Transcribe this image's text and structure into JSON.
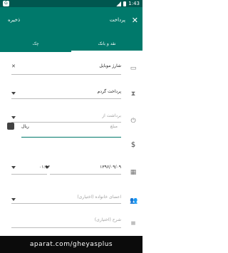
{
  "statusbar": {
    "left_badge": "G",
    "time": "1:43",
    "battery": ""
  },
  "header": {
    "title": "پرداخت",
    "save_label": "ذخیره",
    "close_symbol": "✕"
  },
  "tabs": [
    {
      "label": "نقد و بانک"
    },
    {
      "label": "چک"
    }
  ],
  "form": {
    "account": {
      "value": "شارژ موبایل",
      "clear_symbol": "✕"
    },
    "category": {
      "value": "پرداخت گردم"
    },
    "from": {
      "placeholder": "برداشت از"
    },
    "amount": {
      "placeholder": "مبلغ",
      "currency": "ریال"
    },
    "date": {
      "value": "۱۳۹۶/۰۹/۰۹",
      "time": "۰۱:۴۳"
    },
    "family": {
      "placeholder": "اعضای خانواده (اختیاری)"
    },
    "desc": {
      "placeholder": "شرح (اختیاری)"
    }
  },
  "footer": {
    "text": "aparat.com/gheyasplus"
  },
  "colors": {
    "primary": "#00796b",
    "primary_dark": "#00574f"
  },
  "icons": [
    "wallet-icon",
    "hourglass-icon",
    "power-icon",
    "dollar-icon",
    "calendar-icon",
    "people-icon",
    "notes-icon",
    "calculator-icon"
  ]
}
